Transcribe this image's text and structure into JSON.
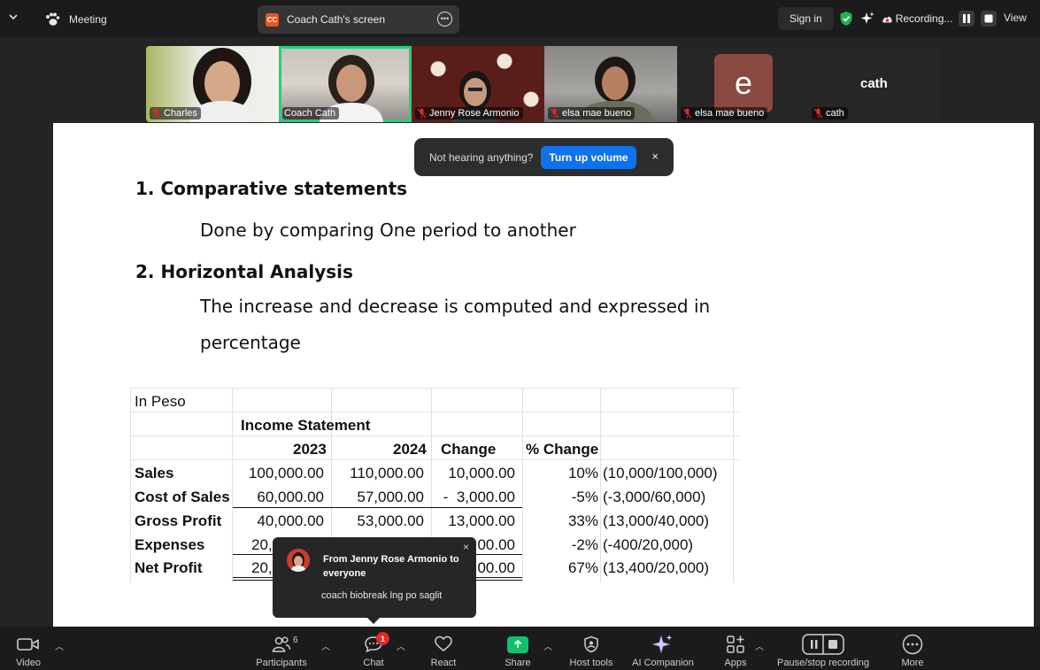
{
  "topbar": {
    "meeting_label": "Meeting",
    "screen_tab_badge": "CC",
    "screen_tab_label": "Coach Cath's screen",
    "sign_in": "Sign in",
    "recording": "Recording...",
    "view": "View"
  },
  "participants_strip": [
    {
      "name": "Charles"
    },
    {
      "name": "Coach Cath"
    },
    {
      "name": "Jenny Rose Armonio"
    },
    {
      "name": "elsa mae bueno"
    },
    {
      "name": "elsa mae bueno",
      "initial": "e"
    },
    {
      "name": "cath",
      "display": "cath"
    }
  ],
  "notice": {
    "text": "Not hearing anything?",
    "button": "Turn up volume",
    "close": "×"
  },
  "slide": {
    "heading1": "1. Comparative statements",
    "text1": "Done by comparing One period to another",
    "heading2": "2. Horizontal Analysis",
    "text2_line1": "The increase and decrease is computed and expressed in",
    "text2_line2": "percentage"
  },
  "table": {
    "unit": "In Peso",
    "title": "Income Statement",
    "headers": [
      "2023",
      "2024",
      "Change",
      "% Change"
    ],
    "rows": [
      {
        "label": "Sales",
        "y2023": "100,000.00",
        "y2024": "110,000.00",
        "change": "10,000.00",
        "pct": "10%",
        "formula": "(10,000/100,000)"
      },
      {
        "label": "Cost of Sales",
        "y2023": "60,000.00",
        "y2024": "57,000.00",
        "change": "-  3,000.00",
        "pct": "-5%",
        "formula": "(-3,000/60,000)"
      },
      {
        "label": "Gross Profit",
        "y2023": "40,000.00",
        "y2024": "53,000.00",
        "change": "13,000.00",
        "pct": "33%",
        "formula": "(13,000/40,000)"
      },
      {
        "label": "Expenses",
        "y2023": "20,",
        "y2024": "",
        "change": "00.00",
        "pct": "-2%",
        "formula": "(-400/20,000)"
      },
      {
        "label": "Net Profit",
        "y2023": "20,",
        "y2024": "",
        "change": "00.00",
        "pct": "67%",
        "formula": "(13,400/20,000)"
      }
    ]
  },
  "chat_popup": {
    "from": "From Jenny Rose Armonio to everyone",
    "message": "coach biobreak lng po saglit",
    "close": "×"
  },
  "toolbar": {
    "video": "Video",
    "participants": "Participants",
    "participants_count": "6",
    "chat": "Chat",
    "chat_badge": "1",
    "react": "React",
    "share": "Share",
    "host_tools": "Host tools",
    "ai_companion": "AI Companion",
    "apps": "Apps",
    "pause_stop": "Pause/stop recording",
    "more": "More"
  },
  "colors": {
    "accent_blue": "#0e72ed",
    "active_speaker": "#23d07b",
    "share_green": "#0fc26a",
    "badge_red": "#e02828",
    "shield_green": "#23b14d"
  }
}
